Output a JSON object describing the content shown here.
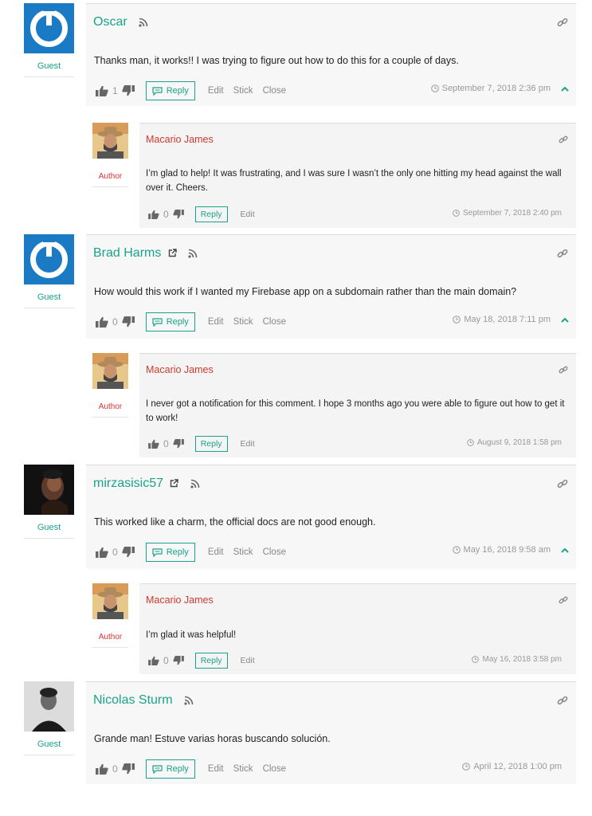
{
  "comments": [
    {
      "author": "Oscar",
      "role": "Guest",
      "text": "Thanks man, it works!! I was trying to figure out how to do this for a couple of days.",
      "votes": "1",
      "reply_label": "Reply",
      "edit_label": "Edit",
      "stick_label": "Stick",
      "close_label": "Close",
      "date": "September 7, 2018 2:36 pm",
      "reply": {
        "author": "Macario James",
        "role": "Author",
        "text": "I’m glad to help! It was frustrating, and I was sure I wasn’t the only one hitting my head against the wall over it. Cheers.",
        "votes": "0",
        "reply_label": "Reply",
        "edit_label": "Edit",
        "date": "September 7, 2018 2:40 pm"
      }
    },
    {
      "author": "Brad Harms",
      "role": "Guest",
      "text": "How would this work if I wanted my Firebase app on a subdomain rather than the main domain?",
      "votes": "0",
      "reply_label": "Reply",
      "edit_label": "Edit",
      "stick_label": "Stick",
      "close_label": "Close",
      "date": "May 18, 2018 7:11 pm",
      "reply": {
        "author": "Macario James",
        "role": "Author",
        "text": "I never got a notification for this comment. I hope 3 months ago you were able to figure out how to get it to work!",
        "votes": "0",
        "reply_label": "Reply",
        "edit_label": "Edit",
        "date": "August 9, 2018 1:58 pm"
      }
    },
    {
      "author": "mirzasisic57",
      "role": "Guest",
      "text": "This worked like a charm, the official docs are not good enough.",
      "votes": "0",
      "reply_label": "Reply",
      "edit_label": "Edit",
      "stick_label": "Stick",
      "close_label": "Close",
      "date": "May 16, 2018 9:58 am",
      "reply": {
        "author": "Macario James",
        "role": "Author",
        "text": "I’m glad it was helpful!",
        "votes": "0",
        "reply_label": "Reply",
        "edit_label": "Edit",
        "date": "May 16, 2018 3:58 pm"
      }
    },
    {
      "author": "Nicolas Sturm",
      "role": "Guest",
      "text": "Grande man! Estuve varias horas buscando solución.",
      "votes": "0",
      "reply_label": "Reply",
      "edit_label": "Edit",
      "stick_label": "Stick",
      "close_label": "Close",
      "date": "April 12, 2018 1:00 pm"
    }
  ],
  "colors": {
    "accent": "#1aa38a",
    "author_red": "#d03a2e",
    "card_bg": "#f7f7f7"
  },
  "icons": [
    "gravatar-default-icon",
    "rss-icon",
    "external-link-icon",
    "permalink-icon",
    "thumbs-up-icon",
    "thumbs-down-icon",
    "reply-bubble-icon",
    "clock-icon",
    "chevron-up-icon"
  ]
}
